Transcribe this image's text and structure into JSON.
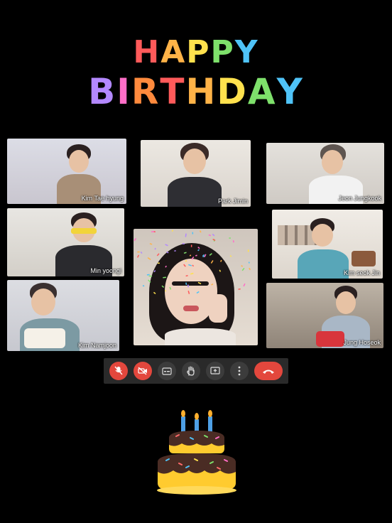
{
  "banner": {
    "line1": "HAPPY",
    "line2": "BIRTHDAY",
    "letter_colors": [
      "#ff5a5a",
      "#ffb347",
      "#ffe14d",
      "#7ee06b",
      "#4fc3f7",
      "#b388ff",
      "#ff6ec7",
      "#ff8a3d"
    ]
  },
  "participants": [
    {
      "name": "Kim Tae hyung"
    },
    {
      "name": "Park Jimin"
    },
    {
      "name": "Jeon Jungkook"
    },
    {
      "name": "Min yoongi"
    },
    {
      "name": "Kim seok Jin"
    },
    {
      "name": "Kim Namjoon"
    },
    {
      "name": "Jung Hoseok"
    },
    {
      "name": ""
    }
  ],
  "toolbar": {
    "buttons": [
      "mic-off-icon",
      "camera-off-icon",
      "captions-icon",
      "raise-hand-icon",
      "present-screen-icon",
      "more-options-icon",
      "end-call-icon"
    ],
    "accent": "#e3473d"
  },
  "decor": {
    "cake": "birthday-cake-icon"
  }
}
